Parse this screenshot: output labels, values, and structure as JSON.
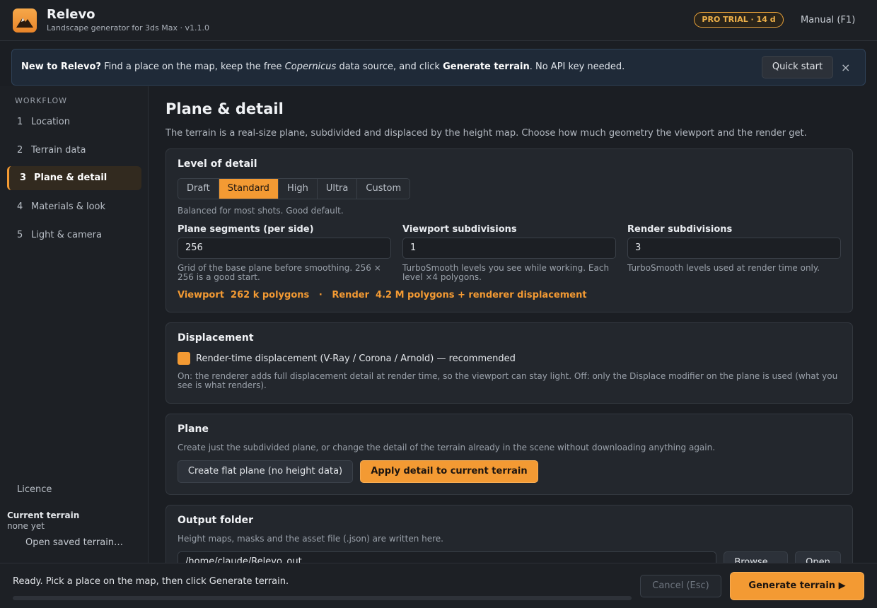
{
  "header": {
    "app_name": "Relevo",
    "subtitle": "Landscape generator for 3ds Max  ·  v1.1.0",
    "badge": "PRO TRIAL · 14 d",
    "manual": "Manual  (F1)",
    "logo_icon": "mountain-icon"
  },
  "banner": {
    "bold_lead": "New to Relevo?",
    "text_1": " Find a place on the map, keep the free ",
    "italic": "Copernicus",
    "text_2": " data source, and click ",
    "bold_action": "Generate terrain",
    "text_3": ". No API key needed.",
    "button": "Quick start",
    "close": "×"
  },
  "sidebar": {
    "section_label": "WORKFLOW",
    "items": [
      {
        "num": "1",
        "label": "Location"
      },
      {
        "num": "2",
        "label": "Terrain data"
      },
      {
        "num": "3",
        "label": "Plane & detail"
      },
      {
        "num": "4",
        "label": "Materials & look"
      },
      {
        "num": "5",
        "label": "Light & camera"
      }
    ],
    "licence": "Licence",
    "current_terrain_title": "Current terrain",
    "current_terrain_value": "none yet",
    "open_saved": "Open saved terrain…"
  },
  "main": {
    "title": "Plane & detail",
    "description": "The terrain is a real-size plane, subdivided and displaced by the height map. Choose how much geometry the viewport and the render get.",
    "lod": {
      "title": "Level of detail",
      "options": [
        "Draft",
        "Standard",
        "High",
        "Ultra",
        "Custom"
      ],
      "selected": "Standard",
      "hint": "Balanced for most shots. Good default.",
      "fields": [
        {
          "label": "Plane segments (per side)",
          "value": "256",
          "hint": "Grid of the base plane before smoothing. 256 × 256 is a good start."
        },
        {
          "label": "Viewport subdivisions",
          "value": "1",
          "hint": "TurboSmooth levels you see while working. Each level ×4 polygons."
        },
        {
          "label": "Render subdivisions",
          "value": "3",
          "hint": "TurboSmooth levels used at render time only."
        }
      ],
      "viewport_summary": "Viewport  262 k polygons",
      "separator": "   ·   ",
      "render_summary": "Render  4.2 M polygons + renderer displacement"
    },
    "displacement": {
      "title": "Displacement",
      "checkbox_label": "Render-time displacement (V-Ray / Corona / Arnold)  — recommended",
      "checked": true,
      "hint": "On: the renderer adds full displacement detail at render time, so the viewport can stay light. Off: only the Displace modifier on the plane is used (what you see is what renders)."
    },
    "plane": {
      "title": "Plane",
      "hint": "Create just the subdivided plane, or change the detail of the terrain already in the scene without downloading anything again.",
      "btn_flat": "Create flat plane (no height data)",
      "btn_apply": "Apply detail to current terrain"
    },
    "output": {
      "title": "Output folder",
      "hint": "Height maps, masks and the asset file (.json) are written here.",
      "path": "/home/claude/Relevo_out",
      "browse": "Browse…",
      "open": "Open"
    }
  },
  "footer": {
    "status": "Ready. Pick a place on the map, then click Generate terrain.",
    "progress": 0,
    "cancel": "Cancel  (Esc)",
    "generate": "Generate terrain  ▶"
  },
  "colors": {
    "accent": "#f39a33",
    "background": "#1b1e23",
    "card": "#23272d",
    "banner": "#1f2a38"
  }
}
